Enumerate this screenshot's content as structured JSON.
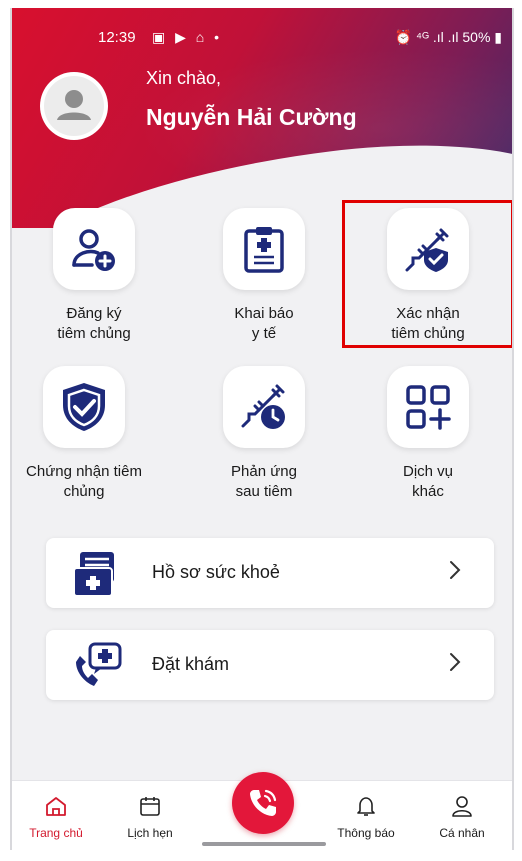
{
  "status_bar": {
    "time": "12:39",
    "left_icons": "▣ ▶ ⌂ •",
    "right_text": "⏰ ⁴ᴳ .ıl .ıl 50% ▮"
  },
  "header": {
    "greeting": "Xin chào,",
    "username": "Nguyễn Hải Cường"
  },
  "services": [
    {
      "label": "Đăng ký\ntiêm chủng",
      "icon": "user-add-icon"
    },
    {
      "label": "Khai báo\ny tế",
      "icon": "clipboard-medical-icon"
    },
    {
      "label": "Xác nhận\ntiêm chủng",
      "icon": "syringe-shield-icon"
    },
    {
      "label": "Chứng nhận tiêm\nchủng",
      "icon": "shield-check-icon"
    },
    {
      "label": "Phản ứng\nsau tiêm",
      "icon": "syringe-clock-icon"
    },
    {
      "label": "Dịch vụ\nkhác",
      "icon": "grid-plus-icon"
    }
  ],
  "cards": [
    {
      "label": "Hồ sơ sức khoẻ",
      "icon": "health-record-icon"
    },
    {
      "label": "Đặt khám",
      "icon": "chat-medical-icon"
    }
  ],
  "bottom_nav": {
    "home": "Trang chủ",
    "schedule": "Lịch hẹn",
    "notifications": "Thông báo",
    "profile": "Cá nhân"
  },
  "colors": {
    "brand_red": "#d31a2e",
    "icon_navy": "#1e2a7a",
    "highlight": "#e00000"
  }
}
